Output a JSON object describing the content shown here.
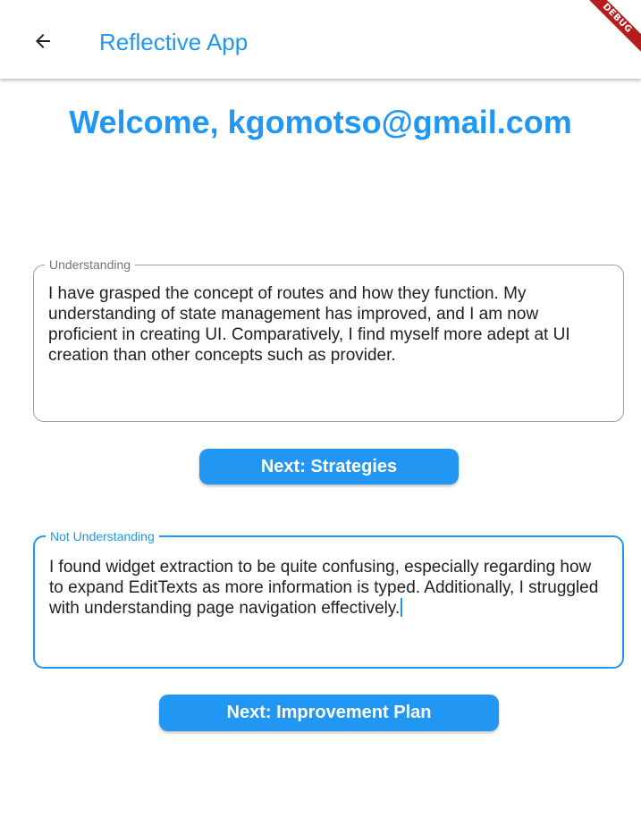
{
  "appbar": {
    "back_icon": "arrow-back-icon",
    "title": "Reflective App",
    "debug_banner": "DEBUG"
  },
  "main": {
    "welcome": "Welcome, kgomotso@gmail.com",
    "understanding": {
      "label": "Understanding",
      "value": "I have grasped the concept of routes and how they function. My understanding of state management has improved, and I am now proficient in creating UI. Comparatively, I find myself more adept at UI creation than other concepts such as provider."
    },
    "strategies_button": "Next: Strategies",
    "not_understanding": {
      "label": "Not Understanding",
      "value": "I found widget extraction to be quite confusing, especially regarding how to expand EditTexts as more information is typed. Additionally, I struggled with understanding page navigation effectively."
    },
    "improvement_button": "Next: Improvement Plan"
  },
  "colors": {
    "accent": "#2196f3",
    "debug": "#b71c1c",
    "outline": "#9e9e9e",
    "text": "#212121"
  }
}
